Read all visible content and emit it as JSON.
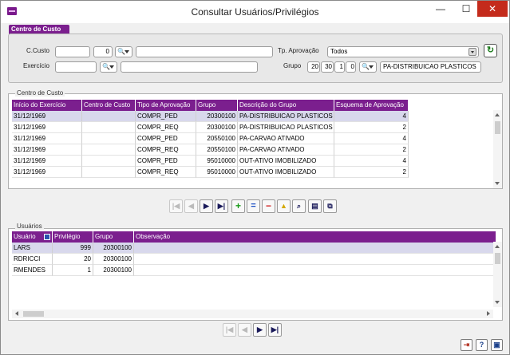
{
  "window": {
    "title": "Consultar Usuários/Privilégios",
    "min_glyph": "—",
    "max_glyph": "☐",
    "close_glyph": "✕"
  },
  "tab": {
    "label": "Centro de Custo"
  },
  "filters": {
    "ccusto_label": "C.Custo",
    "ccusto_value": "",
    "ccusto_seq": "0",
    "ccusto_desc": "",
    "exercicio_label": "Exercício",
    "exercicio_value": "",
    "exercicio_desc": "",
    "tp_aprovacao_label": "Tp. Aprovação",
    "tp_aprovacao_value": "Todos",
    "grupo_label": "Grupo",
    "grupo_parts": [
      "20",
      "30",
      "1",
      "0"
    ],
    "grupo_desc": "PA-DISTRIBUICAO PLASTICOS",
    "lookup_glyph": "🔍",
    "refresh_glyph": "↻"
  },
  "centro": {
    "section_title": "Centro de Custo",
    "columns": [
      "Início do Exercício",
      "Centro de Custo",
      "Tipo de Aprovação",
      "Grupo",
      "Descrição do Grupo",
      "Esquema de Aprovação"
    ],
    "rows": [
      [
        "31/12/1969",
        "",
        "COMPR_PED",
        "20300100",
        "PA-DISTRIBUICAO PLASTICOS",
        "4"
      ],
      [
        "31/12/1969",
        "",
        "COMPR_REQ",
        "20300100",
        "PA-DISTRIBUICAO PLASTICOS",
        "2"
      ],
      [
        "31/12/1969",
        "",
        "COMPR_PED",
        "20550100",
        "PA-CARVAO ATIVADO",
        "4"
      ],
      [
        "31/12/1969",
        "",
        "COMPR_REQ",
        "20550100",
        "PA-CARVAO ATIVADO",
        "2"
      ],
      [
        "31/12/1969",
        "",
        "COMPR_PED",
        "95010000",
        "OUT-ATIVO IMOBILIZADO",
        "4"
      ],
      [
        "31/12/1969",
        "",
        "COMPR_REQ",
        "95010000",
        "OUT-ATIVO IMOBILIZADO",
        "2"
      ]
    ]
  },
  "toolbar1": {
    "first": "|◀",
    "prev": "◀",
    "next": "▶",
    "last": "▶|",
    "add": "+",
    "equal": "=",
    "remove": "−",
    "up": "▲",
    "search": "⌕",
    "view": "▤",
    "export": "⧉"
  },
  "usuarios": {
    "section_title": "Usuários",
    "columns": [
      "Usuário",
      "Privilégio",
      "Grupo",
      "Observação"
    ],
    "rows": [
      [
        "LARS",
        "999",
        "20300100",
        ""
      ],
      [
        "RDRICCI",
        "20",
        "20300100",
        ""
      ],
      [
        "RMENDES",
        "1",
        "20300100",
        ""
      ]
    ]
  },
  "toolbar2": {
    "first": "|◀",
    "prev": "◀",
    "next": "▶",
    "last": "▶|"
  },
  "footer": {
    "exit": "⇥",
    "help": "?",
    "info": "▣"
  },
  "colors": {
    "accent": "#7b1f8e",
    "selected_row": "#d8d8ec",
    "close_button": "#c42b1c"
  }
}
